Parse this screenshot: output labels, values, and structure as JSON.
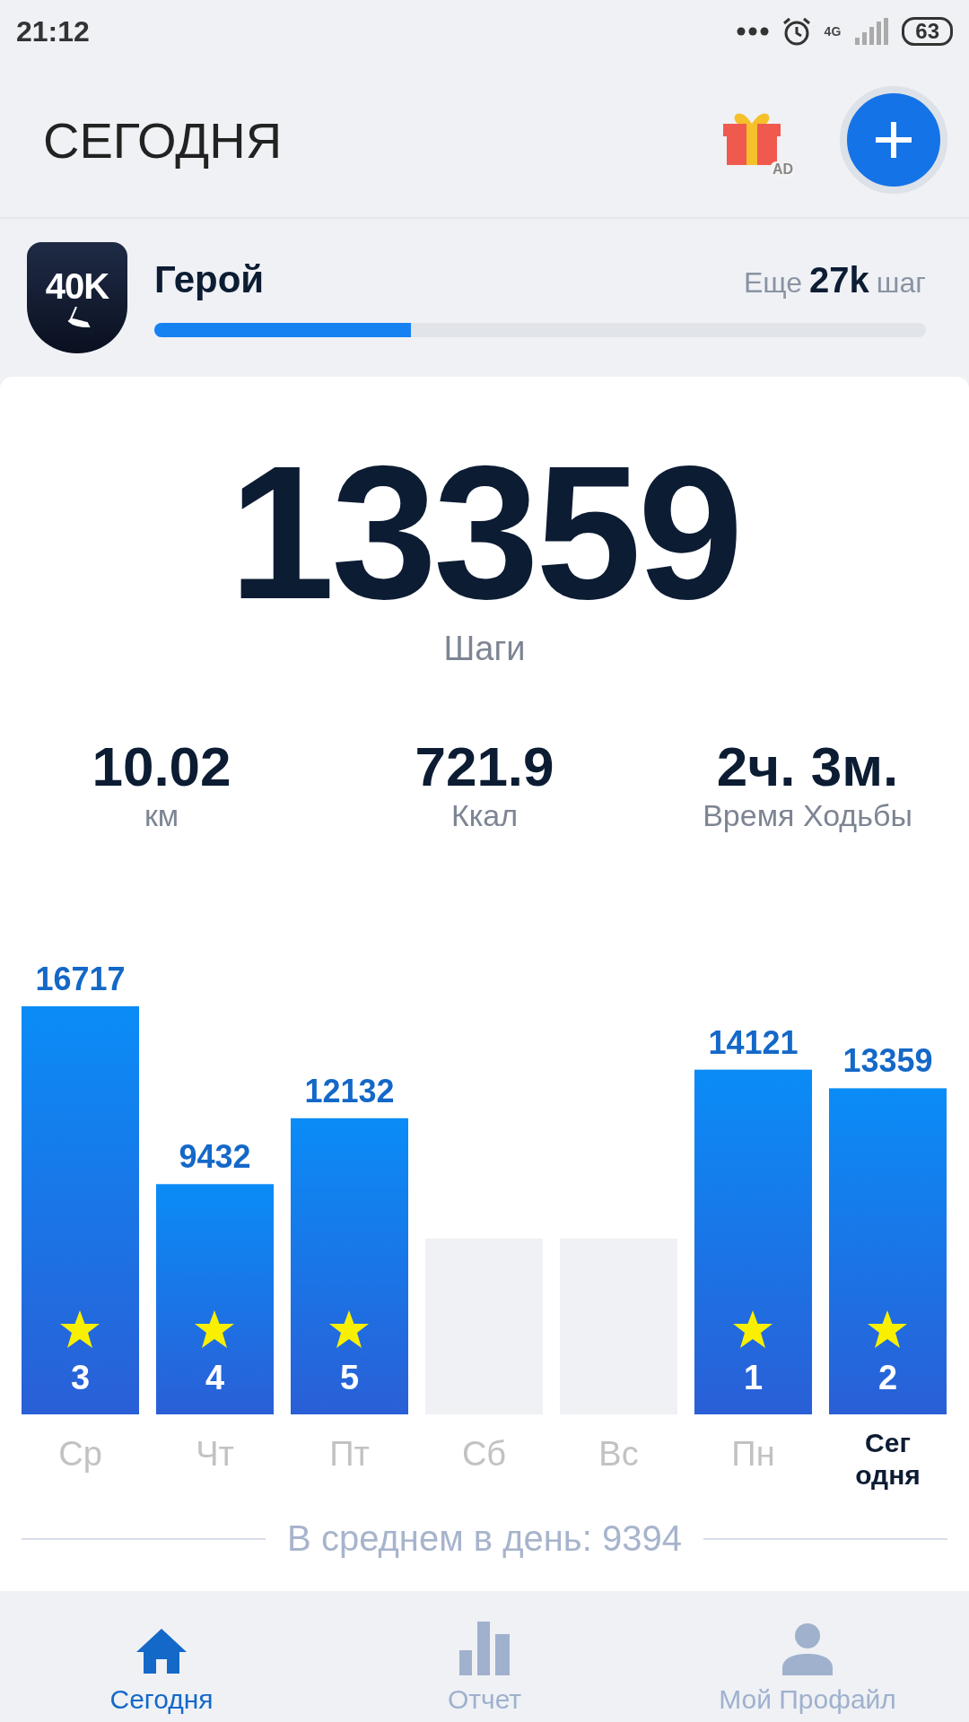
{
  "status_bar": {
    "time": "21:12",
    "network": "4G",
    "battery": "63"
  },
  "header": {
    "title": "СЕГОДНЯ",
    "gift_badge": "AD"
  },
  "goal": {
    "badge": "40K",
    "name": "Герой",
    "remaining_prefix": "Еще",
    "remaining_value": "27k",
    "remaining_suffix": "шаг",
    "level": 0.333
  },
  "steps": {
    "value": "13359",
    "label": "Шаги"
  },
  "stats": [
    {
      "value": "10.02",
      "label": "км"
    },
    {
      "value": "721.9",
      "label": "Ккал"
    },
    {
      "value": "2ч. 3м.",
      "label": "Время Ходьбы"
    }
  ],
  "weekly": {
    "chart_data": {
      "type": "bar",
      "categories": [
        "Ср",
        "Чт",
        "Пт",
        "Сб",
        "Вс",
        "Пн",
        "Сег одня"
      ],
      "values": [
        16717,
        9432,
        12132,
        null,
        null,
        14121,
        13359
      ],
      "data_labels": true
    },
    "days": [
      {
        "rank": "3",
        "selected": false
      },
      {
        "rank": "4",
        "selected": false
      },
      {
        "rank": "5",
        "selected": false
      },
      {
        "selected": false
      },
      {
        "selected": false
      },
      {
        "rank": "1",
        "selected": false
      },
      {
        "rank": "2",
        "selected": true
      }
    ],
    "average": "В среднем в день: 9394"
  },
  "nav": [
    {
      "label": "Сегодня",
      "kind": "home",
      "selected": true
    },
    {
      "label": "Отчет",
      "kind": "report",
      "selected": false
    },
    {
      "label": "Мой Профайл",
      "kind": "profile",
      "selected": false
    }
  ]
}
